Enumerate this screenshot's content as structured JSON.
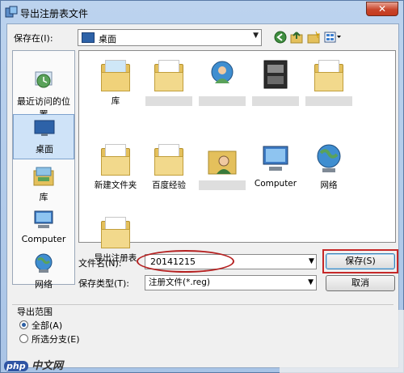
{
  "window": {
    "title": "导出注册表文件",
    "close_glyph": "✕"
  },
  "location": {
    "label": "保存在(I):",
    "value": "桌面"
  },
  "places": [
    {
      "label": "最近访问的位置"
    },
    {
      "label": "桌面"
    },
    {
      "label": "库"
    },
    {
      "label": "Computer"
    },
    {
      "label": "网络"
    }
  ],
  "files": [
    {
      "label": "库"
    },
    {
      "label": ""
    },
    {
      "label": ""
    },
    {
      "label": ""
    },
    {
      "label": ""
    },
    {
      "label": "新建文件夹"
    },
    {
      "label": "百度经验"
    },
    {
      "label": ""
    },
    {
      "label": "Computer"
    },
    {
      "label": "网络"
    },
    {
      "label": "导出注册表"
    }
  ],
  "form": {
    "filename_label": "文件名(N):",
    "filename_value": "20141215",
    "filetype_label": "保存类型(T):",
    "filetype_value": "注册文件(*.reg)",
    "save_button": "保存(S)",
    "cancel_button": "取消"
  },
  "export_range": {
    "title": "导出范围",
    "options": [
      {
        "label": "全部(A)",
        "selected": true
      },
      {
        "label": "所选分支(E)",
        "selected": false
      }
    ]
  },
  "watermark": {
    "brand": "php",
    "site": "中文网"
  },
  "colors": {
    "highlight": "#c62828",
    "selected_place": "#cfe3f8",
    "folder": "#e4c05c"
  }
}
